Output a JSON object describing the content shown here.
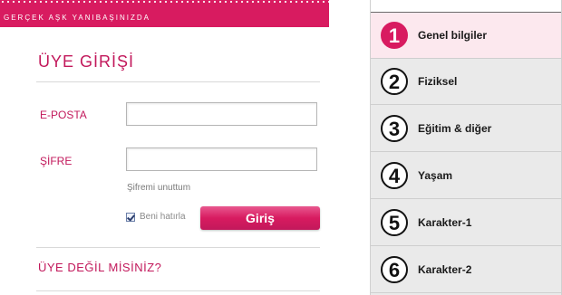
{
  "banner": {
    "tagline": "GERÇEK AŞK YANIBAŞINIZDA"
  },
  "login": {
    "title": "ÜYE GİRİŞİ",
    "email_label": "E-POSTA",
    "email_value": "",
    "password_label": "ŞİFRE",
    "password_value": "",
    "forgot_link": "Şifremi unuttum",
    "remember_label": "Beni hatırla",
    "remember_checked": true,
    "submit_label": "Giriş",
    "not_member": "ÜYE DEĞİL MİSİNİZ?"
  },
  "steps": {
    "items": [
      {
        "number": "1",
        "label": "Genel bilgiler",
        "active": true
      },
      {
        "number": "2",
        "label": "Fiziksel",
        "active": false
      },
      {
        "number": "3",
        "label": "Eğitim & diğer",
        "active": false
      },
      {
        "number": "4",
        "label": "Yaşam",
        "active": false
      },
      {
        "number": "5",
        "label": "Karakter-1",
        "active": false
      },
      {
        "number": "6",
        "label": "Karakter-2",
        "active": false
      }
    ]
  },
  "colors": {
    "accent": "#d81b60",
    "accent_dark": "#c2185b",
    "step_bg": "#eaeaea",
    "active_step_bg": "#fce8ee"
  }
}
